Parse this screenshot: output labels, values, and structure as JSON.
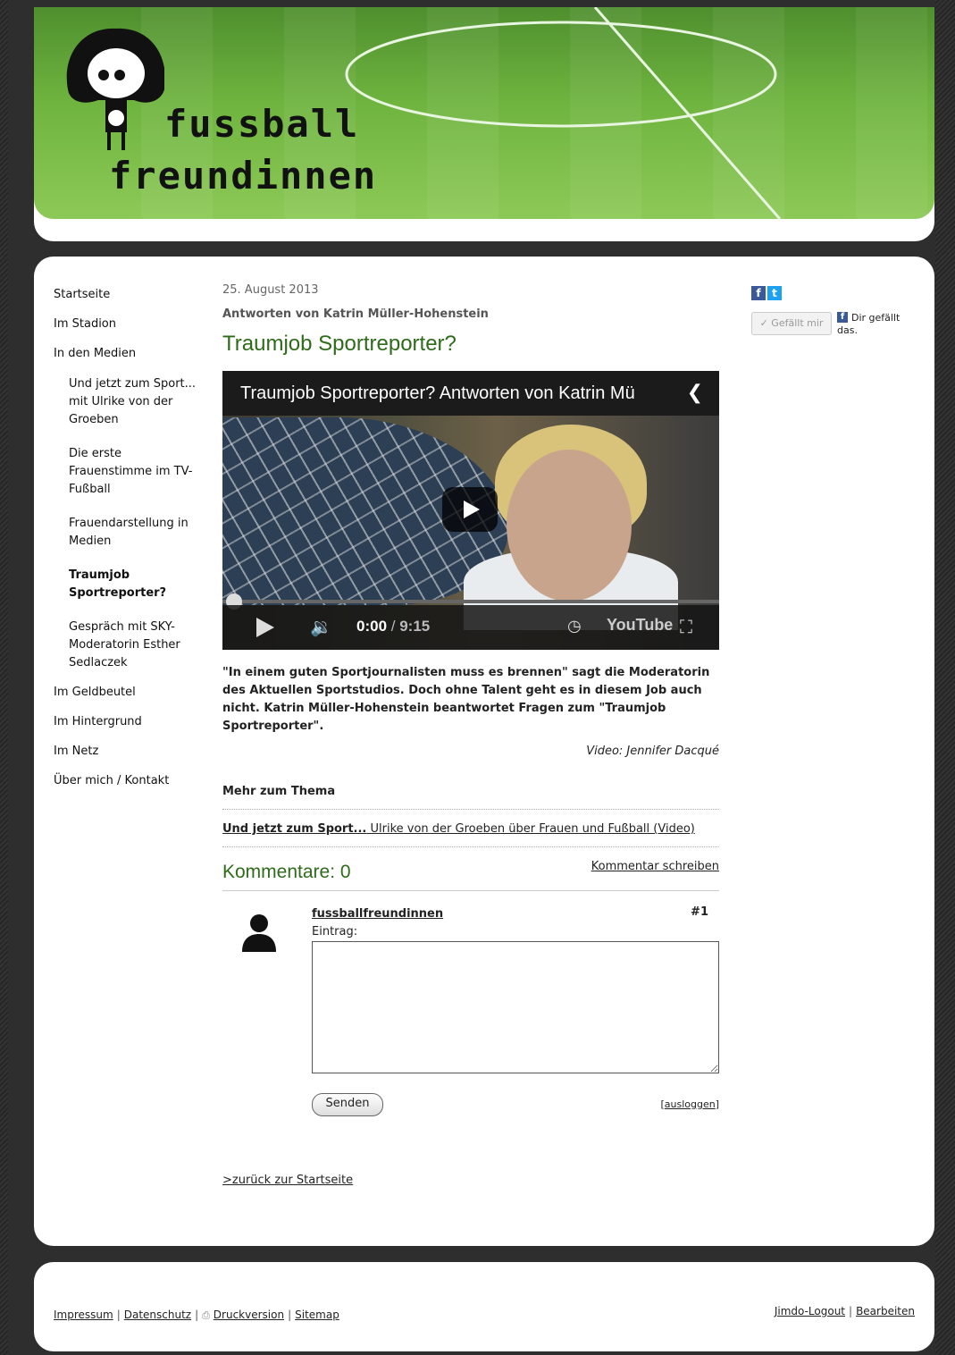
{
  "header": {
    "logo_line1": "fussball",
    "logo_line2": "freundinnen"
  },
  "nav": {
    "items": [
      {
        "label": "Startseite"
      },
      {
        "label": "Im Stadion"
      },
      {
        "label": "In den Medien"
      }
    ],
    "sub_items": [
      {
        "label": "Und jetzt zum Sport... mit Ulrike von der Groeben"
      },
      {
        "label": "Die erste Frauenstimme im TV-Fußball"
      },
      {
        "label": "Frauendarstellung in Medien"
      },
      {
        "label": "Traumjob Sportreporter?"
      },
      {
        "label": "Gespräch mit SKY-Moderatorin Esther Sedlaczek"
      }
    ],
    "bottom_items": [
      {
        "label": "Im Geldbeutel"
      },
      {
        "label": "Im Hintergrund"
      },
      {
        "label": "Im Netz"
      },
      {
        "label": "Über mich / Kontakt"
      }
    ]
  },
  "article": {
    "date": "25. August 2013",
    "subtitle": "Antworten von Katrin Müller-Hohenstein",
    "title": "Traumjob Sportreporter?",
    "lead": "\"In einem guten Sportjournalisten muss es brennen\" sagt die Moderatorin des Aktuellen Sportstudios. Doch ohne Talent geht es in diesem Job auch nicht. Katrin Müller-Hohenstein beantwortet Fragen zum \"Traumjob Sportreporter\".",
    "credit": "Video: Jennifer Dacqué",
    "more_heading": "Mehr zum Thema",
    "more_link_bold": "Und jetzt zum Sport...",
    "more_link_rest": " Ulrike von der Groeben über Frauen und Fußball (Video)",
    "back_link": ">zurück zur Startseite"
  },
  "video": {
    "title": "Traumjob Sportreporter? Antworten von Katrin Mü",
    "time": "0:00",
    "duration": "9:15",
    "brand": "YouTube",
    "progress": 0
  },
  "comments": {
    "heading": "Kommentare: 0",
    "write_link": "Kommentar schreiben",
    "author": "fussballfreundinnen",
    "number": "#1",
    "entry_label": "Eintrag:",
    "entry_value": "",
    "send_label": "Senden",
    "logout_label": "ausloggen"
  },
  "social": {
    "like_button": "Gefällt mir",
    "like_text": "Dir gefällt das."
  },
  "footer": {
    "impressum": "Impressum",
    "datenschutz": "Datenschutz",
    "druck": "Druckversion",
    "sitemap": "Sitemap",
    "jimdo_logout": "Jimdo-Logout",
    "bearbeiten": "Bearbeiten"
  },
  "colors": {
    "accent_green": "#2e6b1a",
    "facebook": "#3b5998",
    "twitter": "#1da1f2"
  }
}
